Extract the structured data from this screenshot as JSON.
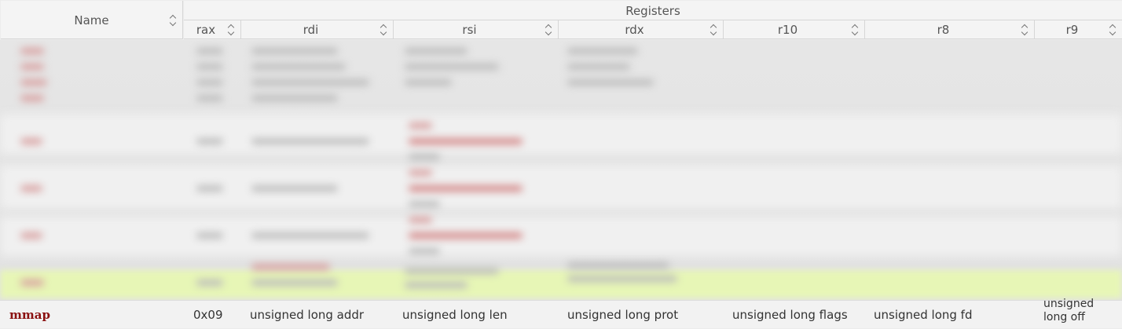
{
  "header": {
    "name_label": "Name",
    "group_label": "Registers",
    "columns": [
      {
        "key": "rax",
        "label": "rax"
      },
      {
        "key": "rdi",
        "label": "rdi"
      },
      {
        "key": "rsi",
        "label": "rsi"
      },
      {
        "key": "rdx",
        "label": "rdx"
      },
      {
        "key": "r10",
        "label": "r10"
      },
      {
        "key": "r8",
        "label": "r8"
      },
      {
        "key": "r9",
        "label": "r9"
      }
    ]
  },
  "row": {
    "name": "mmap",
    "rax": "0x09",
    "rdi": "unsigned long addr",
    "rsi": "unsigned long len",
    "rdx": "unsigned long prot",
    "r10": "unsigned long flags",
    "r8": "unsigned long fd",
    "r9": "unsigned long off"
  },
  "colors": {
    "name_text": "#8a1010",
    "highlight_row": "#e7f6b6",
    "header_bg": "#f4f4f4"
  }
}
